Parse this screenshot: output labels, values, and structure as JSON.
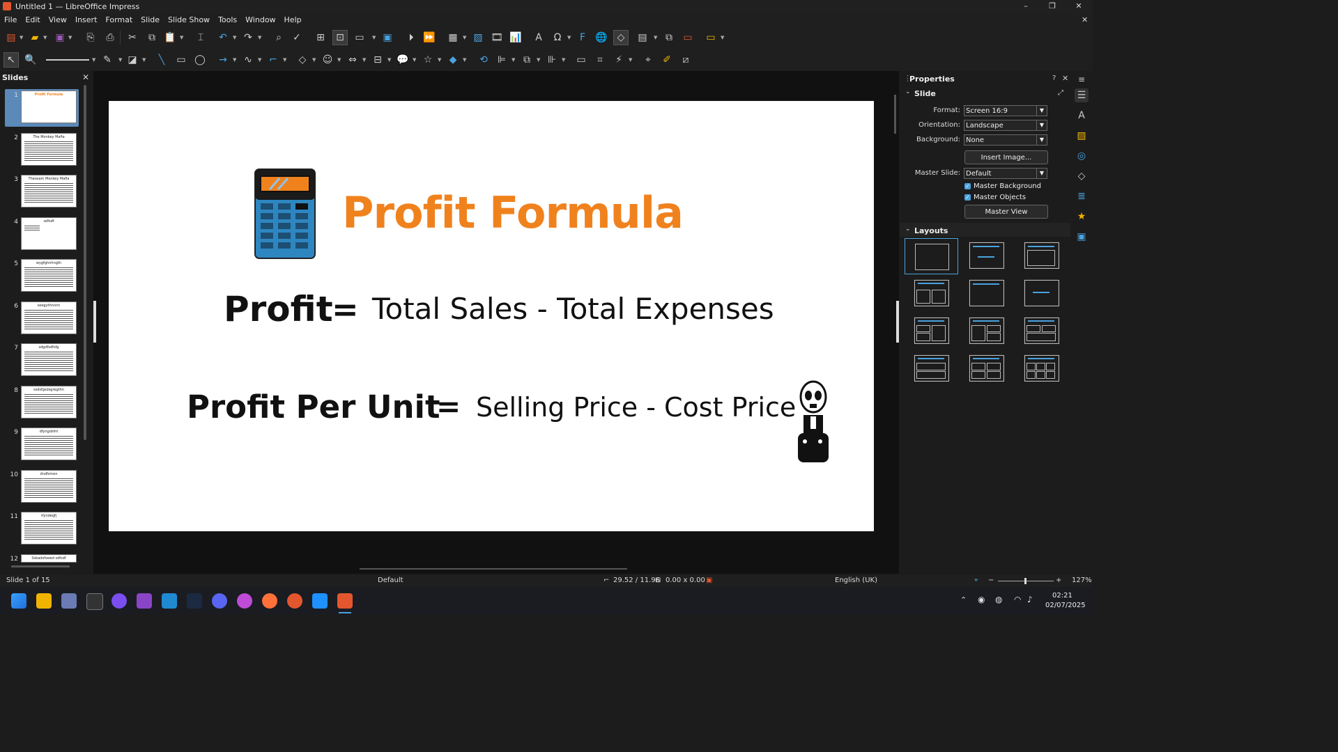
{
  "window": {
    "title": "Untitled 1 — LibreOffice Impress",
    "minimize": "–",
    "maximize": "❐",
    "close": "✕"
  },
  "menu": [
    "File",
    "Edit",
    "View",
    "Insert",
    "Format",
    "Slide",
    "Slide Show",
    "Tools",
    "Window",
    "Help"
  ],
  "slides_pane": {
    "header": "Slides",
    "close": "✕",
    "thumbs": [
      {
        "num": "1",
        "title": "Profit Formula"
      },
      {
        "num": "2",
        "title": "The Monkey Mafia"
      },
      {
        "num": "3",
        "title": "Theosam Monkey Mafia"
      },
      {
        "num": "4",
        "title": "sdfsdf"
      },
      {
        "num": "5",
        "title": "wygfghnhngth"
      },
      {
        "num": "6",
        "title": "seegythnnnn"
      },
      {
        "num": "7",
        "title": "sdgdfsdfsfg"
      },
      {
        "num": "8",
        "title": "ssdsfgsdsgregthn"
      },
      {
        "num": "9",
        "title": "dfyngdsfnt"
      },
      {
        "num": "10",
        "title": "dndfzmen"
      },
      {
        "num": "11",
        "title": "rfyndegfj"
      },
      {
        "num": "12",
        "title": "Sdsadsfsewd sdfsdf"
      }
    ]
  },
  "slide": {
    "title": "Profit Formula",
    "line1_left": "Profit",
    "line1_eq": "=",
    "line1_right": "Total Sales - Total Expenses",
    "line2_left": "Profit Per Unit",
    "line2_eq": "=",
    "line2_right": "Selling Price - Cost Price",
    "brand_orange": "#F0821E",
    "calc_blue": "#2E86C1"
  },
  "properties": {
    "header": "Properties",
    "help": "?",
    "close": "✕",
    "menu": "≡",
    "slide_section": "Slide",
    "format_label": "Format:",
    "format_value": "Screen 16:9",
    "orientation_label": "Orientation:",
    "orientation_value": "Landscape",
    "background_label": "Background:",
    "background_value": "None",
    "insert_image": "Insert Image...",
    "master_slide_label": "Master Slide:",
    "master_slide_value": "Default",
    "master_background": "Master Background",
    "master_objects": "Master Objects",
    "master_view": "Master View",
    "layouts_section": "Layouts"
  },
  "status": {
    "slide": "Slide 1 of 15",
    "master": "Default",
    "position": "29.52 / 11.96",
    "size": "0.00 x 0.00",
    "language": "English (UK)",
    "zoom": "127%"
  },
  "taskbar": {
    "time": "02:21",
    "date": "02/07/2025"
  }
}
